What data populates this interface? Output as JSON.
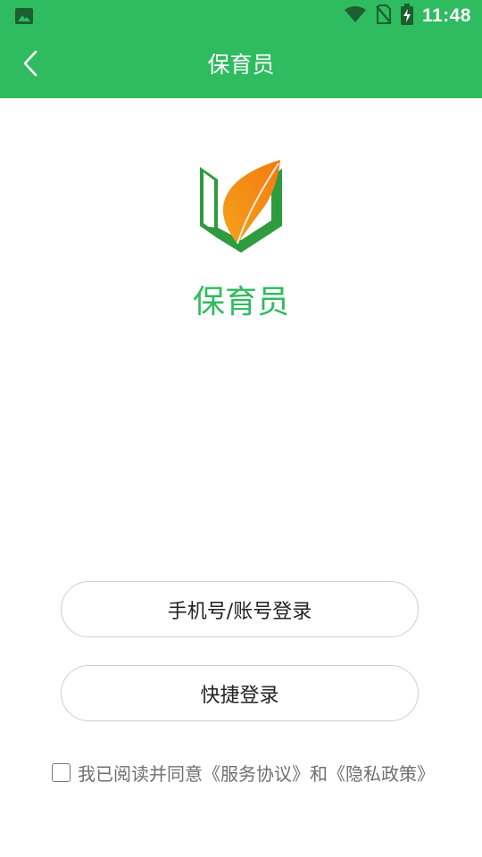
{
  "status_bar": {
    "time": "11:48",
    "left_icon": "image-icon",
    "icons": [
      "wifi-icon",
      "no-sim-icon",
      "battery-charging-icon"
    ],
    "background": "#2fbb5f"
  },
  "app_bar": {
    "title": "保育员",
    "back_icon": "chevron-left-icon",
    "background": "#2fbb5f"
  },
  "brand": {
    "name": "保育员",
    "color": "#2fbb5f",
    "logo_icon": "leaf-book-logo"
  },
  "buttons": {
    "account_login": "手机号/账号登录",
    "quick_login": "快捷登录"
  },
  "agreement": {
    "prefix": "我已阅读并同意",
    "service_agreement": "《服务协议》",
    "joiner": "和",
    "privacy_policy": "《隐私政策》",
    "checked": false
  }
}
